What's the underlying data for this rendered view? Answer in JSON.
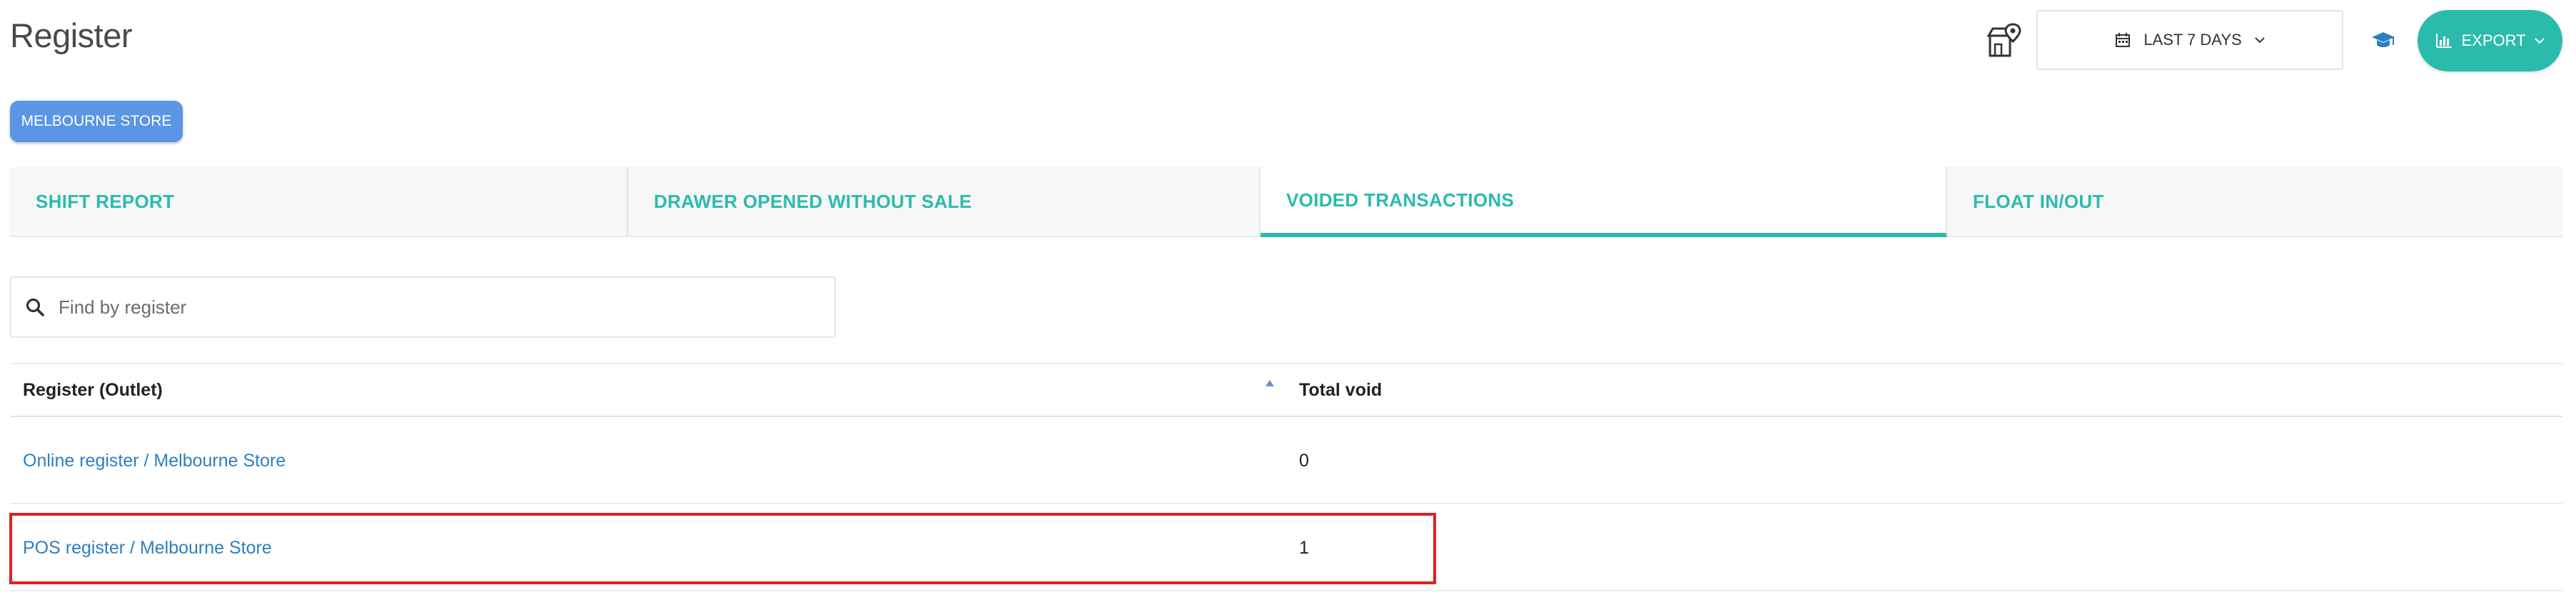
{
  "page": {
    "title": "Register"
  },
  "toolbar": {
    "date_range_label": "LAST 7 DAYS",
    "export_label": "EXPORT"
  },
  "outlet_chip": {
    "label": "MELBOURNE STORE"
  },
  "tabs": [
    {
      "label": "SHIFT REPORT",
      "active": false
    },
    {
      "label": "DRAWER OPENED WITHOUT SALE",
      "active": false
    },
    {
      "label": "VOIDED TRANSACTIONS",
      "active": true
    },
    {
      "label": "FLOAT IN/OUT",
      "active": false
    }
  ],
  "search": {
    "placeholder": "Find by register",
    "value": ""
  },
  "table": {
    "columns": [
      "Register (Outlet)",
      "Total void"
    ],
    "sort": {
      "column": "Register (Outlet)",
      "direction": "ascending"
    },
    "rows": [
      {
        "register": "Online register / Melbourne Store",
        "total_void": "0"
      },
      {
        "register": "POS register / Melbourne Store",
        "total_void": "1",
        "highlighted": true
      }
    ]
  },
  "colors": {
    "accent": "#2bbbad",
    "chip": "#5b95e6",
    "link": "#2e7fc1",
    "highlight": "#e0201f"
  },
  "icons": {
    "store_location": "store-location-icon",
    "calendar": "calendar-icon",
    "tutorial": "graduation-cap-icon",
    "export": "bar-chart-icon",
    "search": "search-icon",
    "sort": "sort-ascending-icon"
  }
}
